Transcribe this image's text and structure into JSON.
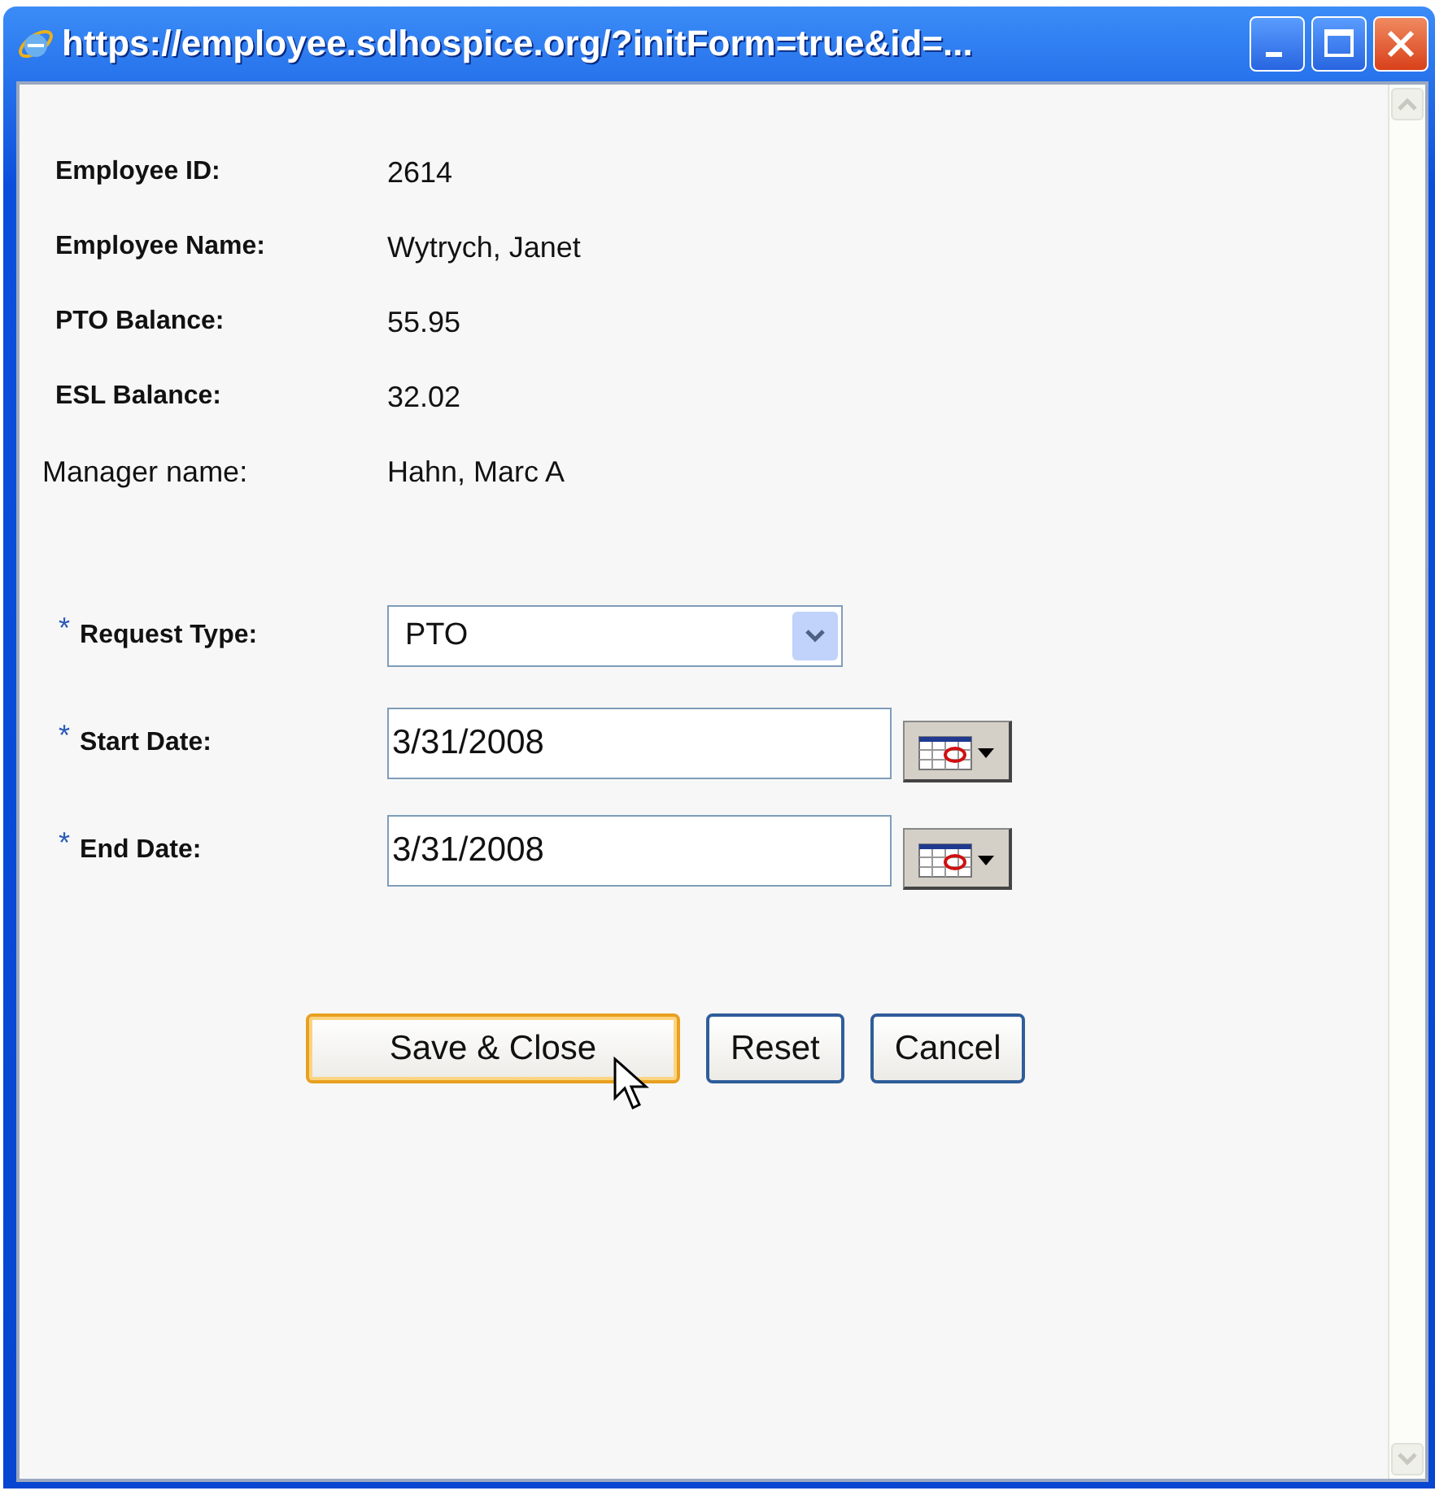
{
  "window": {
    "title": "https://employee.sdhospice.org/?initForm=true&id=..."
  },
  "info": [
    {
      "label": "Employee ID:",
      "value": "2614",
      "bold": true
    },
    {
      "label": "Employee Name:",
      "value": "Wytrych, Janet",
      "bold": true
    },
    {
      "label": "PTO Balance:",
      "value": "55.95",
      "bold": true
    },
    {
      "label": "ESL Balance:",
      "value": "32.02",
      "bold": true
    },
    {
      "label": "Manager name:",
      "value": "Hahn, Marc A",
      "bold": false
    }
  ],
  "form": [
    {
      "kind": "select",
      "label": "Request Type:",
      "marker": "*",
      "value": "PTO"
    },
    {
      "kind": "date",
      "label": "Start Date:",
      "marker": "*",
      "value": "3/31/2008"
    },
    {
      "kind": "date",
      "label": "End Date:",
      "marker": "*",
      "value": "3/31/2008"
    }
  ],
  "buttons": [
    {
      "label": "Save & Close",
      "hovered": true
    },
    {
      "label": "Reset",
      "hovered": false
    },
    {
      "label": "Cancel",
      "hovered": false
    }
  ]
}
